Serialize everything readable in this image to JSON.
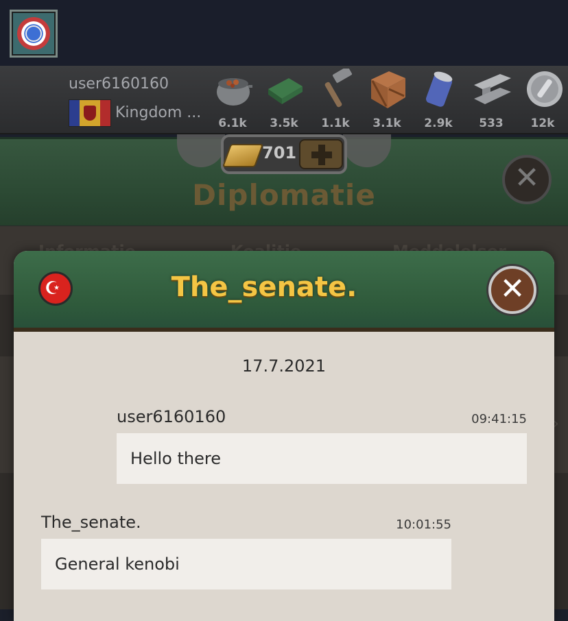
{
  "topbar": {
    "username": "user6160160",
    "kingdom": "Kingdom ...",
    "resources": [
      {
        "name": "food-pot-icon",
        "count": "6.1k",
        "color": "#8a8d90"
      },
      {
        "name": "cloth-icon",
        "count": "3.5k",
        "color": "#3e7a4a"
      },
      {
        "name": "hammer-icon",
        "count": "1.1k",
        "color": "#8a6e52"
      },
      {
        "name": "wood-crate-icon",
        "count": "3.1k",
        "color": "#a9683d"
      },
      {
        "name": "oil-barrel-icon",
        "count": "2.9k",
        "color": "#5266b8"
      },
      {
        "name": "steel-beam-icon",
        "count": "533",
        "color": "#9a9ca0"
      },
      {
        "name": "coin-icon",
        "count": "12k",
        "color": "#b7b9bc"
      }
    ]
  },
  "header": {
    "gold": "701",
    "title": "Diplomatie"
  },
  "tabs": [
    "Informatie",
    "Koalitie",
    "Meddelelser"
  ],
  "chat": {
    "title": "The_senate.",
    "date": "17.7.2021",
    "messages": [
      {
        "sender": "user6160160",
        "time": "09:41:15",
        "text": "Hello there"
      },
      {
        "sender": "The_senate.",
        "time": "10:01:55",
        "text": "General kenobi"
      }
    ]
  },
  "colors": {
    "title_gold": "#f4c544",
    "header_green": "#2f5a3b",
    "paper": "#ddd7cf"
  }
}
